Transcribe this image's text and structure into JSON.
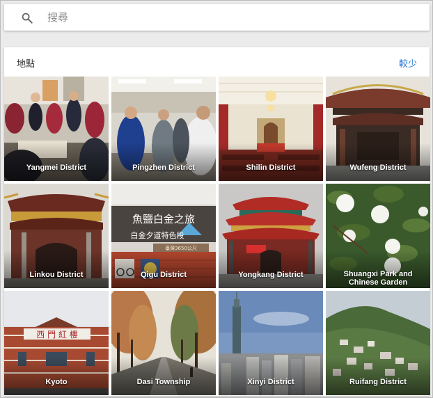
{
  "search": {
    "placeholder": "搜尋",
    "value": ""
  },
  "section": {
    "title": "地點",
    "toggle_label": "較少"
  },
  "places": [
    {
      "name": "Yangmei District"
    },
    {
      "name": "Pingzhen District"
    },
    {
      "name": "Shilin District"
    },
    {
      "name": "Wufeng District"
    },
    {
      "name": "Linkou District"
    },
    {
      "name": "Qigu District"
    },
    {
      "name": "Yongkang District"
    },
    {
      "name": "Shuangxi Park and Chinese Garden"
    },
    {
      "name": "Kyoto"
    },
    {
      "name": "Dasi Township"
    },
    {
      "name": "Xinyi District"
    },
    {
      "name": "Ruifang District"
    }
  ],
  "photo_text": {
    "qigu_sign_line1": "魚鹽白金之旅",
    "qigu_sign_line2": "白金夕道特色段",
    "qigu_sign_line3": "臺灣3650公尺",
    "kyoto_sign": "西 門 紅 樓"
  },
  "colors": {
    "link": "#2b7bd8",
    "background": "#ebebeb"
  }
}
